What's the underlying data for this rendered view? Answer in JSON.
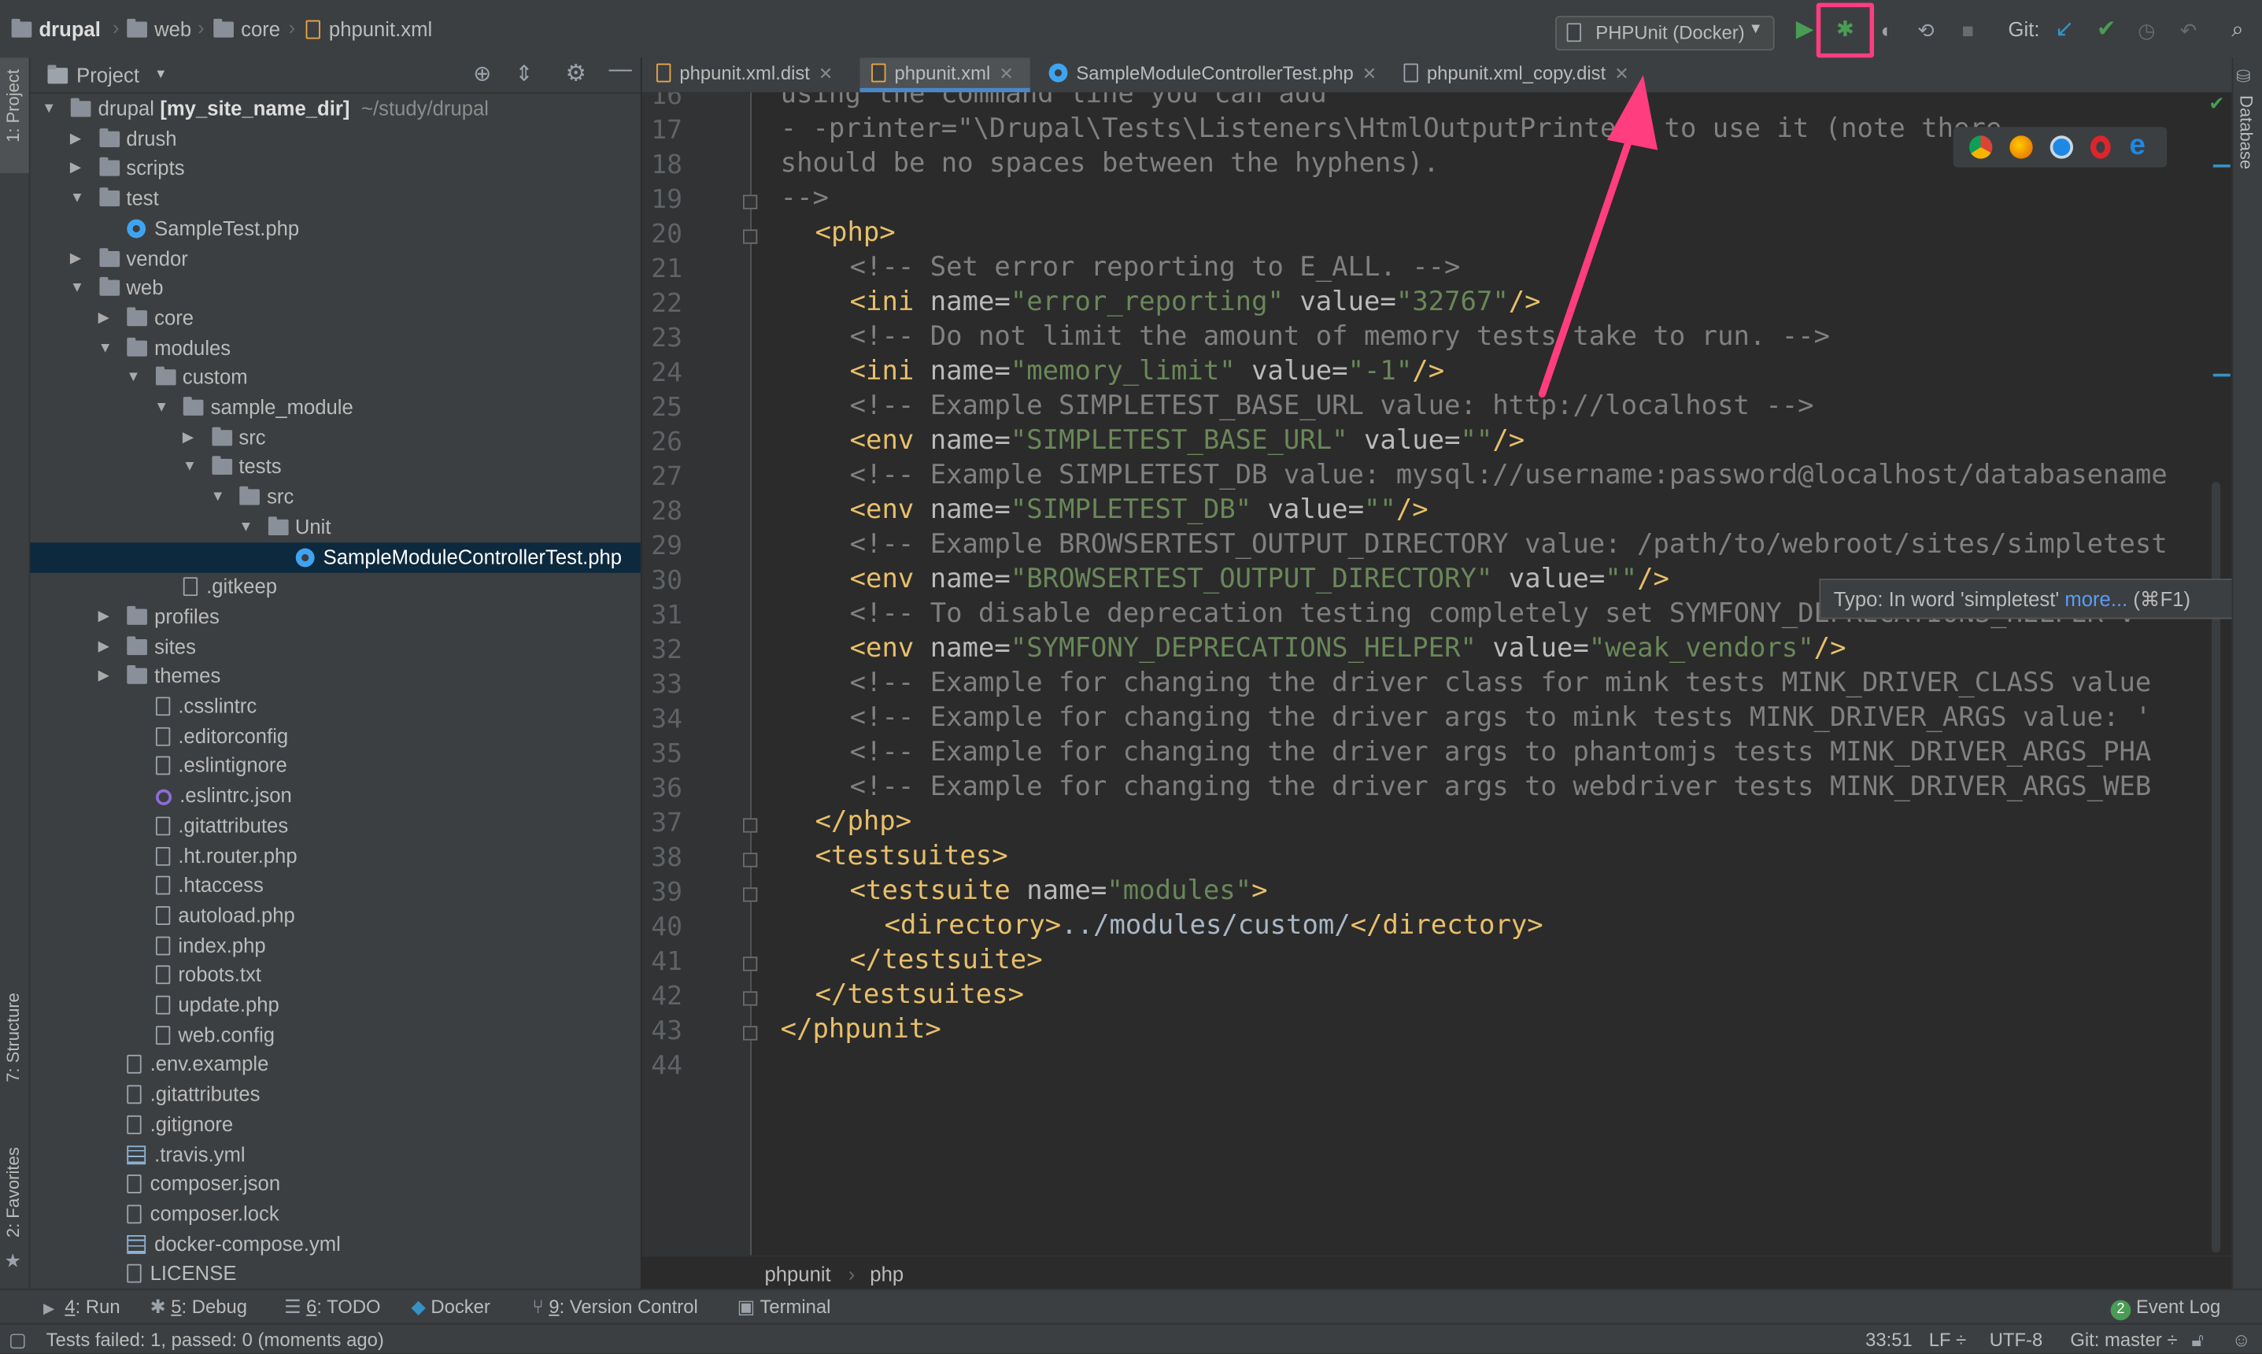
{
  "breadcrumbs": [
    "drupal",
    "web",
    "core",
    "phpunit.xml"
  ],
  "run_config": "PHPUnit (Docker)",
  "git_label": "Git:",
  "project_panel": {
    "title": "Project",
    "tree": [
      {
        "label": "drupal",
        "extra_bold": "[my_site_name_dir]",
        "extra": "~/study/drupal",
        "depth": 0,
        "type": "folder",
        "open": true
      },
      {
        "label": "drush",
        "depth": 1,
        "type": "folder",
        "open": false
      },
      {
        "label": "scripts",
        "depth": 1,
        "type": "folder",
        "open": false
      },
      {
        "label": "test",
        "depth": 1,
        "type": "folder",
        "open": true
      },
      {
        "label": "SampleTest.php",
        "depth": 2,
        "type": "php"
      },
      {
        "label": "vendor",
        "depth": 1,
        "type": "folder",
        "open": false
      },
      {
        "label": "web",
        "depth": 1,
        "type": "folder",
        "open": true
      },
      {
        "label": "core",
        "depth": 2,
        "type": "folder",
        "open": false
      },
      {
        "label": "modules",
        "depth": 2,
        "type": "folder",
        "open": true
      },
      {
        "label": "custom",
        "depth": 3,
        "type": "folder",
        "open": true
      },
      {
        "label": "sample_module",
        "depth": 4,
        "type": "folder",
        "open": true
      },
      {
        "label": "src",
        "depth": 5,
        "type": "folder",
        "open": false
      },
      {
        "label": "tests",
        "depth": 5,
        "type": "folder",
        "open": true
      },
      {
        "label": "src",
        "depth": 6,
        "type": "folder",
        "open": true
      },
      {
        "label": "Unit",
        "depth": 7,
        "type": "folder",
        "open": true
      },
      {
        "label": "SampleModuleControllerTest.php",
        "depth": 8,
        "type": "php",
        "selected": true
      },
      {
        "label": ".gitkeep",
        "depth": 4,
        "type": "file"
      },
      {
        "label": "profiles",
        "depth": 2,
        "type": "folder",
        "open": false
      },
      {
        "label": "sites",
        "depth": 2,
        "type": "folder",
        "open": false
      },
      {
        "label": "themes",
        "depth": 2,
        "type": "folder",
        "open": false
      },
      {
        "label": ".csslintrc",
        "depth": 3,
        "type": "file"
      },
      {
        "label": ".editorconfig",
        "depth": 3,
        "type": "file"
      },
      {
        "label": ".eslintignore",
        "depth": 3,
        "type": "file"
      },
      {
        "label": ".eslintrc.json",
        "depth": 3,
        "type": "json"
      },
      {
        "label": ".gitattributes",
        "depth": 3,
        "type": "file"
      },
      {
        "label": ".ht.router.php",
        "depth": 3,
        "type": "file"
      },
      {
        "label": ".htaccess",
        "depth": 3,
        "type": "file"
      },
      {
        "label": "autoload.php",
        "depth": 3,
        "type": "file"
      },
      {
        "label": "index.php",
        "depth": 3,
        "type": "file"
      },
      {
        "label": "robots.txt",
        "depth": 3,
        "type": "file"
      },
      {
        "label": "update.php",
        "depth": 3,
        "type": "file"
      },
      {
        "label": "web.config",
        "depth": 3,
        "type": "file"
      },
      {
        "label": ".env.example",
        "depth": 2,
        "type": "file"
      },
      {
        "label": ".gitattributes",
        "depth": 2,
        "type": "file"
      },
      {
        "label": ".gitignore",
        "depth": 2,
        "type": "file"
      },
      {
        "label": ".travis.yml",
        "depth": 2,
        "type": "yml"
      },
      {
        "label": "composer.json",
        "depth": 2,
        "type": "file"
      },
      {
        "label": "composer.lock",
        "depth": 2,
        "type": "file"
      },
      {
        "label": "docker-compose.yml",
        "depth": 2,
        "type": "yml"
      },
      {
        "label": "LICENSE",
        "depth": 2,
        "type": "file"
      }
    ]
  },
  "left_stripe": {
    "project": "1: Project",
    "structure": "7: Structure",
    "favorites": "2: Favorites"
  },
  "right_stripe": {
    "database": "Database"
  },
  "tabs": [
    {
      "label": "phpunit.xml.dist",
      "active": false
    },
    {
      "label": "phpunit.xml",
      "active": true
    },
    {
      "label": "SampleModuleControllerTest.php",
      "active": false
    },
    {
      "label": "phpunit.xml_copy.dist",
      "active": false
    }
  ],
  "editor": {
    "lines": [
      {
        "n": "16",
        "indent": 0,
        "segs": [
          [
            "cm",
            "using the command line you can add"
          ]
        ]
      },
      {
        "n": "17",
        "indent": 0,
        "segs": [
          [
            "cm",
            "- -printer=\"\\Drupal\\Tests\\Listeners\\HtmlOutputPrinter\" to use it (note there"
          ]
        ]
      },
      {
        "n": "18",
        "indent": 0,
        "segs": [
          [
            "cm",
            "should be no spaces between the hyphens)."
          ]
        ]
      },
      {
        "n": "19",
        "indent": 0,
        "segs": [
          [
            "cm",
            "-->"
          ]
        ]
      },
      {
        "n": "20",
        "indent": 1,
        "segs": [
          [
            "tg",
            "<php>"
          ]
        ]
      },
      {
        "n": "21",
        "indent": 2,
        "segs": [
          [
            "cm",
            "<!-- Set error reporting to E_ALL. -->"
          ]
        ]
      },
      {
        "n": "22",
        "indent": 2,
        "segs": [
          [
            "tg",
            "<ini "
          ],
          [
            "at",
            "name="
          ],
          [
            "av",
            "\"error_reporting\" "
          ],
          [
            "at",
            "value="
          ],
          [
            "av",
            "\"32767\""
          ],
          [
            "tg",
            "/>"
          ]
        ]
      },
      {
        "n": "23",
        "indent": 2,
        "segs": [
          [
            "cm",
            "<!-- Do not limit the amount of memory tests take to run. -->"
          ]
        ]
      },
      {
        "n": "24",
        "indent": 2,
        "segs": [
          [
            "tg",
            "<ini "
          ],
          [
            "at",
            "name="
          ],
          [
            "av",
            "\"memory_limit\" "
          ],
          [
            "at",
            "value="
          ],
          [
            "av",
            "\"-1\""
          ],
          [
            "tg",
            "/>"
          ]
        ]
      },
      {
        "n": "25",
        "indent": 2,
        "segs": [
          [
            "cm",
            "<!-- Example SIMPLETEST_BASE_URL value: http://localhost -->"
          ]
        ]
      },
      {
        "n": "26",
        "indent": 2,
        "segs": [
          [
            "tg",
            "<env "
          ],
          [
            "at",
            "name="
          ],
          [
            "av",
            "\"SIMPLETEST_BASE_URL\" "
          ],
          [
            "at",
            "value="
          ],
          [
            "av",
            "\"\""
          ],
          [
            "tg",
            "/>"
          ]
        ]
      },
      {
        "n": "27",
        "indent": 2,
        "segs": [
          [
            "cm",
            "<!-- Example SIMPLETEST_DB value: mysql://username:password@localhost/databasename"
          ]
        ]
      },
      {
        "n": "28",
        "indent": 2,
        "segs": [
          [
            "tg",
            "<env "
          ],
          [
            "at",
            "name="
          ],
          [
            "av",
            "\"SIMPLETEST_DB\" "
          ],
          [
            "at",
            "value="
          ],
          [
            "av",
            "\"\""
          ],
          [
            "tg",
            "/>"
          ]
        ]
      },
      {
        "n": "29",
        "indent": 2,
        "segs": [
          [
            "cm",
            "<!-- Example BROWSERTEST_OUTPUT_DIRECTORY value: /path/to/webroot/sites/simpletest"
          ]
        ]
      },
      {
        "n": "30",
        "indent": 2,
        "segs": [
          [
            "tg",
            "<env "
          ],
          [
            "at",
            "name="
          ],
          [
            "av",
            "\"BROWSERTEST_OUTPUT_DIRECTORY\" "
          ],
          [
            "at",
            "value="
          ],
          [
            "av",
            "\"\""
          ],
          [
            "tg",
            "/>"
          ]
        ]
      },
      {
        "n": "31",
        "indent": 2,
        "segs": [
          [
            "cm",
            "<!-- To disable deprecation testing completely set SYMFONY_DEPRECATIONS_HELPER v"
          ]
        ]
      },
      {
        "n": "32",
        "indent": 2,
        "segs": [
          [
            "tg",
            "<env "
          ],
          [
            "at",
            "name="
          ],
          [
            "av",
            "\"SYMFONY_DEPRECATIONS_HELPER\" "
          ],
          [
            "at",
            "value="
          ],
          [
            "av",
            "\"weak_vendors\""
          ],
          [
            "tg",
            "/>"
          ]
        ]
      },
      {
        "n": "33",
        "indent": 2,
        "segs": [
          [
            "cm",
            "<!-- Example for changing the driver class for mink tests MINK_DRIVER_CLASS value"
          ]
        ]
      },
      {
        "n": "34",
        "indent": 2,
        "segs": [
          [
            "cm",
            "<!-- Example for changing the driver args to mink tests MINK_DRIVER_ARGS value: '"
          ]
        ]
      },
      {
        "n": "35",
        "indent": 2,
        "segs": [
          [
            "cm",
            "<!-- Example for changing the driver args to phantomjs tests MINK_DRIVER_ARGS_PHA"
          ]
        ]
      },
      {
        "n": "36",
        "indent": 2,
        "segs": [
          [
            "cm",
            "<!-- Example for changing the driver args to webdriver tests MINK_DRIVER_ARGS_WEB"
          ]
        ]
      },
      {
        "n": "37",
        "indent": 1,
        "segs": [
          [
            "tg",
            "</php>"
          ]
        ]
      },
      {
        "n": "38",
        "indent": 1,
        "segs": [
          [
            "tg",
            "<testsuites>"
          ]
        ]
      },
      {
        "n": "39",
        "indent": 2,
        "segs": [
          [
            "tg",
            "<testsuite "
          ],
          [
            "at",
            "name="
          ],
          [
            "av",
            "\"modules\""
          ],
          [
            "tg",
            ">"
          ]
        ]
      },
      {
        "n": "40",
        "indent": 3,
        "segs": [
          [
            "tg",
            "<directory>"
          ],
          [
            "tx",
            "../modules/custom/"
          ],
          [
            "tg",
            "</directory>"
          ]
        ]
      },
      {
        "n": "41",
        "indent": 2,
        "segs": [
          [
            "tg",
            "</testsuite>"
          ]
        ]
      },
      {
        "n": "42",
        "indent": 1,
        "segs": [
          [
            "tg",
            "</testsuites>"
          ]
        ]
      },
      {
        "n": "43",
        "indent": 0,
        "segs": [
          [
            "tg",
            "</phpunit>"
          ]
        ]
      },
      {
        "n": "44",
        "indent": 0,
        "segs": []
      }
    ]
  },
  "tooltip": {
    "text": "Typo: In word 'simpletest'",
    "link": "more...",
    "shortcut": "(⌘F1)"
  },
  "editor_breadcrumb": [
    "phpunit",
    "php"
  ],
  "tool_windows": [
    {
      "num": "4",
      "label": ": Run"
    },
    {
      "num": "5",
      "label": ": Debug"
    },
    {
      "num": "6",
      "label": ": TODO"
    },
    {
      "num": "",
      "label": "Docker"
    },
    {
      "num": "9",
      "label": ": Version Control"
    },
    {
      "num": "",
      "label": "Terminal"
    }
  ],
  "event_log": {
    "count": "2",
    "label": "Event Log"
  },
  "status": {
    "message": "Tests failed: 1, passed: 0 (moments ago)",
    "position": "33:51",
    "line_sep": "LF ÷",
    "encoding": "UTF-8",
    "git": "Git: master ÷"
  },
  "colors": {
    "highlight": "#ff3d7f",
    "selection": "#0d293e",
    "accent": "#4a88c7"
  }
}
